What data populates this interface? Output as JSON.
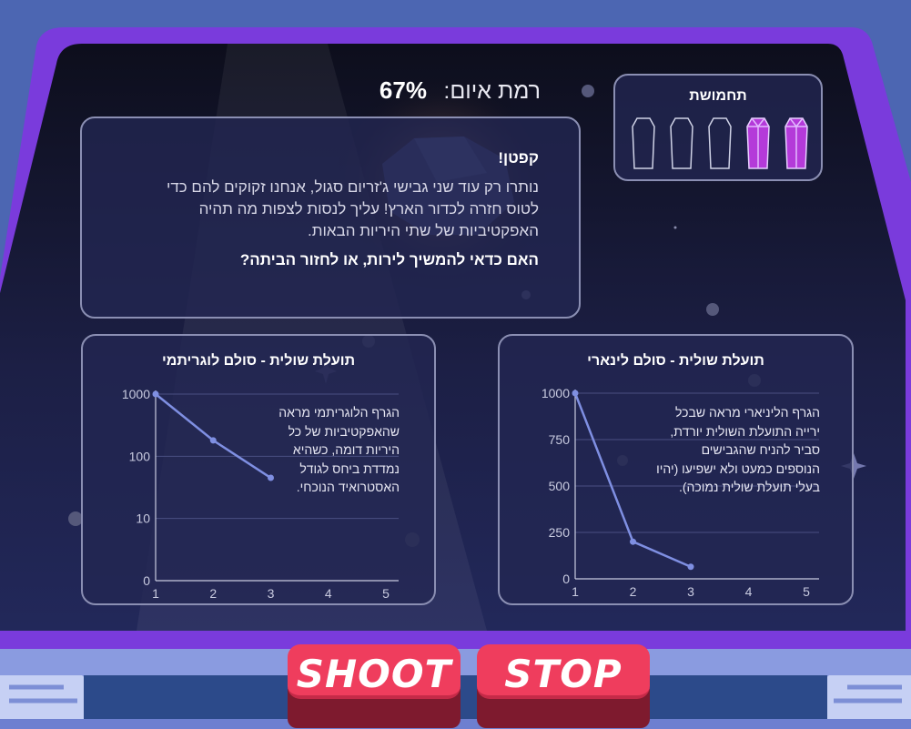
{
  "threat": {
    "label": "רמת איום:",
    "value": "67%"
  },
  "ammo": {
    "title": "תחמושת",
    "total": 5,
    "filled": 2,
    "filled_color": "#b43ad9",
    "empty_color": "#cfd2e6"
  },
  "message": {
    "header": "קפטן!",
    "body": "נותרו רק עוד שני גבישי ג'זריום סגול, אנחנו זקוקים להם כדי לטוס חזרה לכדור הארץ! עליך לנסות לצפות מה תהיה האפקטיביות של שתי היריות הבאות.",
    "question": "האם כדאי להמשיך לירות, או לחזור הביתה?"
  },
  "buttons": {
    "shoot": "SHOOT",
    "stop": "STOP"
  },
  "colors": {
    "accent": "#7a3bdc",
    "line": "#7f8fe2",
    "button": "#ef3d5d"
  },
  "chart_data": [
    {
      "type": "line",
      "title": "תועלת שולית - סולם לוגריתמי",
      "scale": "log",
      "x": [
        1,
        2,
        3
      ],
      "values": [
        1000,
        180,
        45
      ],
      "xticks": [
        1,
        2,
        3,
        4,
        5
      ],
      "yticks": [
        "0",
        "10",
        "100",
        "1000"
      ],
      "xlim": [
        1,
        5
      ],
      "note": "הגרף הלוגריתמי מראה שהאפקטיביות של כל היריות דומה, כשהיא נמדדת ביחס לגודל האסטרואיד הנוכחי."
    },
    {
      "type": "line",
      "title": "תועלת שולית - סולם לינארי",
      "scale": "linear",
      "x": [
        1,
        2,
        3
      ],
      "values": [
        1000,
        200,
        65
      ],
      "xticks": [
        1,
        2,
        3,
        4,
        5
      ],
      "yticks": [
        "0",
        "250",
        "500",
        "750",
        "1000"
      ],
      "xlim": [
        1,
        5
      ],
      "ylim": [
        0,
        1000
      ],
      "note": "הגרף הליניארי מראה שבכל ירייה התועלת השולית יורדת, סביר להניח שהגבישים הנוספים כמעט ולא ישפיעו (יהיו בעלי תועלת שולית נמוכה)."
    }
  ]
}
